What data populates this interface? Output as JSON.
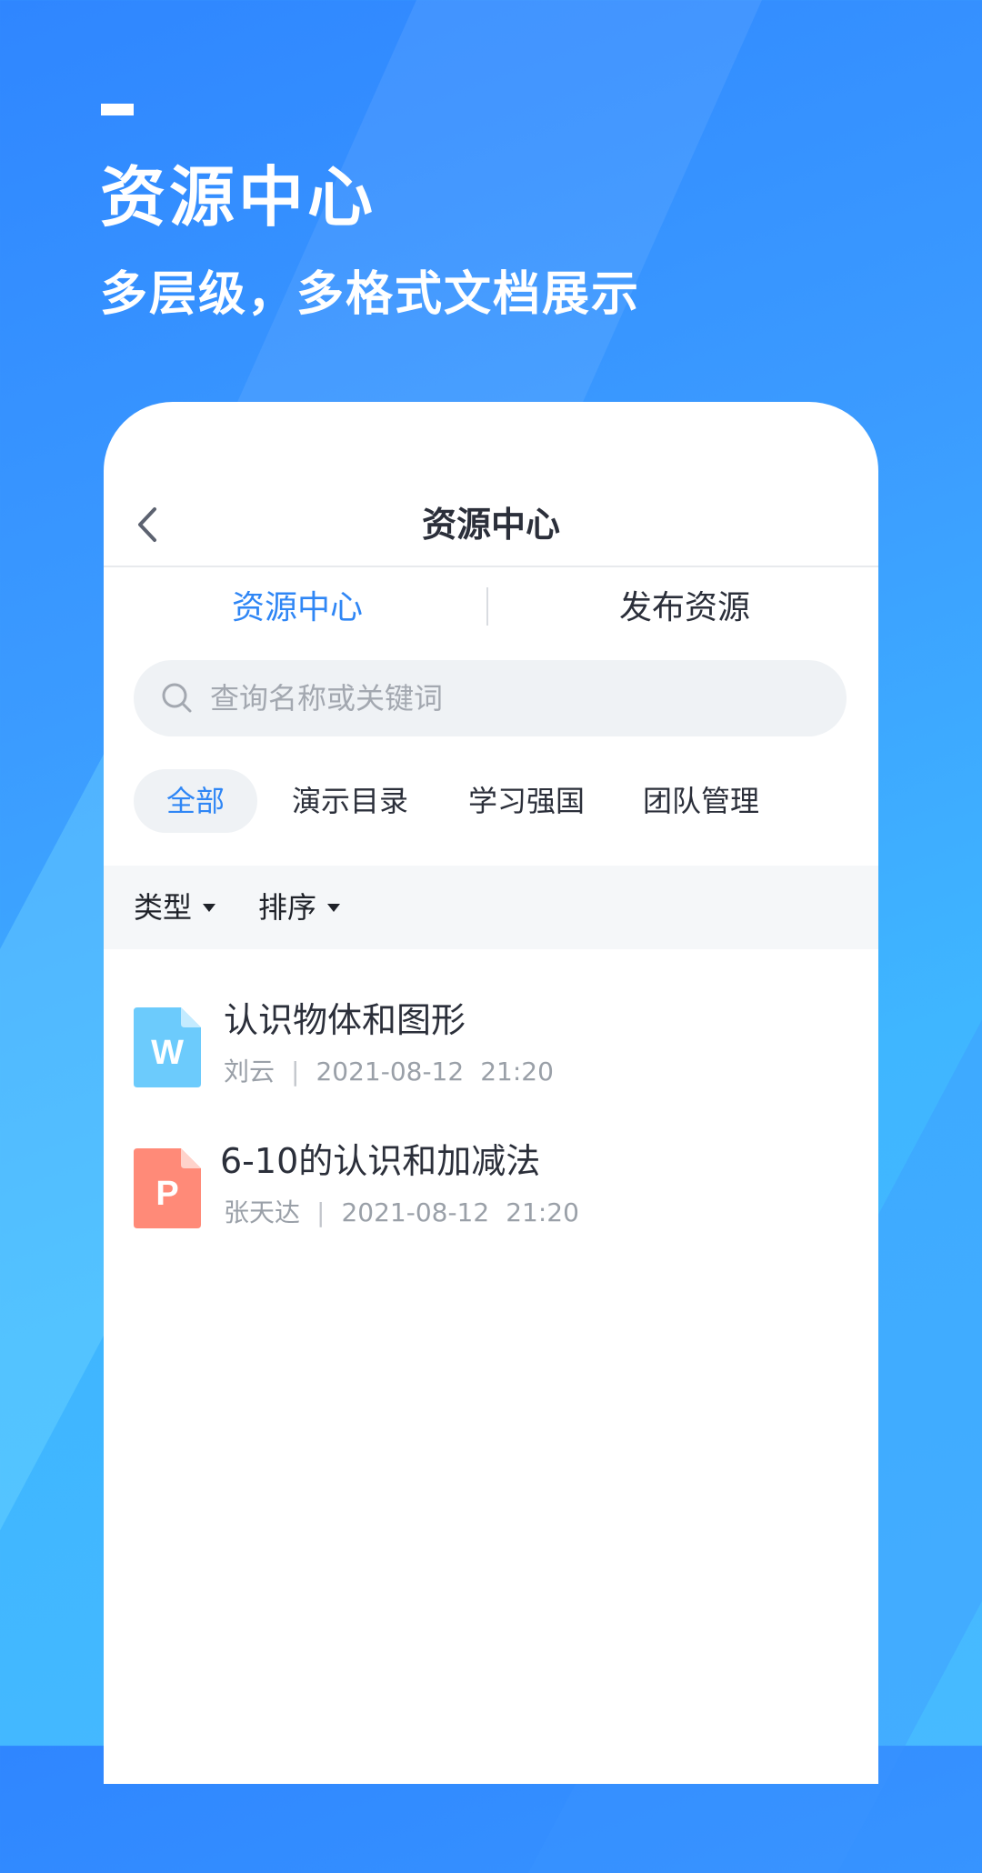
{
  "hero": {
    "title": "资源中心",
    "subtitle": "多层级，多格式文档展示"
  },
  "nav": {
    "title": "资源中心"
  },
  "tabs": [
    {
      "label": "资源中心",
      "active": true
    },
    {
      "label": "发布资源",
      "active": false
    }
  ],
  "search": {
    "placeholder": "查询名称或关键词",
    "value": ""
  },
  "categories": [
    {
      "label": "全部",
      "active": true
    },
    {
      "label": "演示目录",
      "active": false
    },
    {
      "label": "学习强国",
      "active": false
    },
    {
      "label": "团队管理",
      "active": false
    }
  ],
  "filters": [
    {
      "label": "类型"
    },
    {
      "label": "排序"
    }
  ],
  "files": [
    {
      "type_letter": "W",
      "type_color": "#6ccbfc",
      "title": "认识物体和图形",
      "author": "刘云",
      "date": "2021-08-12",
      "time": "21:20"
    },
    {
      "type_letter": "P",
      "type_color": "#ff8a78",
      "title": "6-10的认识和加减法",
      "author": "张天达",
      "date": "2021-08-12",
      "time": "21:20"
    }
  ],
  "colors": {
    "accent": "#2f86f5",
    "background_top": "#2f86ff",
    "background_bottom": "#47baff",
    "chip_bg": "#eff2f5"
  }
}
